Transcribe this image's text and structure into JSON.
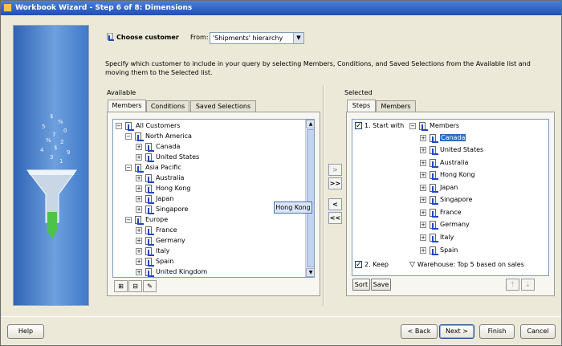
{
  "window": {
    "title": "Workbook Wizard - Step 6 of 8: Dimensions"
  },
  "header": {
    "choose_label": "Choose customer",
    "from_label": "From:",
    "from_value": "'Shipments' hierarchy"
  },
  "instructions": "Specify which customer to include in your query by selecting Members, Conditions, and Saved Selections from the Available list and moving them to the Selected list.",
  "available": {
    "label": "Available",
    "tabs": [
      "Members",
      "Conditions",
      "Saved Selections"
    ],
    "tree": [
      {
        "label": "All Customers"
      },
      {
        "label": "North America"
      },
      {
        "label": "Canada"
      },
      {
        "label": "United States"
      },
      {
        "label": "Asia Pacific"
      },
      {
        "label": "Australia"
      },
      {
        "label": "Hong Kong"
      },
      {
        "label": "Japan"
      },
      {
        "label": "Singapore"
      },
      {
        "label": "Europe"
      },
      {
        "label": "France"
      },
      {
        "label": "Germany"
      },
      {
        "label": "Italy"
      },
      {
        "label": "Spain"
      },
      {
        "label": "United Kingdom"
      }
    ],
    "tooltip": "Hong Kong"
  },
  "selected": {
    "label": "Selected",
    "tabs": [
      "Steps",
      "Members"
    ],
    "step1": "1. Start with",
    "step1_member": "Members",
    "members": [
      "Canada",
      "United States",
      "Australia",
      "Hong Kong",
      "Japan",
      "Singapore",
      "France",
      "Germany",
      "Italy",
      "Spain"
    ],
    "step2": "2. Keep",
    "step2_rule": "Warehouse: Top 5 based on sales",
    "sort_button": "Sort",
    "save_button": "Save"
  },
  "move_buttons": [
    ">",
    ">>",
    "<",
    "<<"
  ],
  "footer": {
    "help": "Help",
    "back": "< Back",
    "next": "Next >",
    "finish": "Finish",
    "cancel": "Cancel"
  }
}
